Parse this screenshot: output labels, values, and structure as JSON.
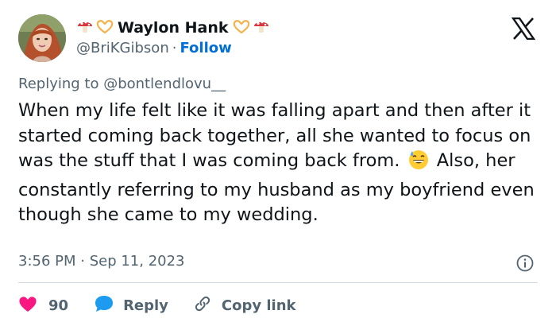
{
  "header": {
    "display_name": "Waylon Hank",
    "handle": "@BriKGibson",
    "separator": "·",
    "follow_label": "Follow"
  },
  "tweet": {
    "replying_to": "Replying to @bontlendlovu__",
    "text_part1": "When my life felt like it was falling apart and then after it started coming back together, all she wanted to focus on was the stuff that I was coming back from.",
    "text_part2": "Also, her constantly referring to my husband as my boyfriend even though she came to my wedding.",
    "timestamp": "3:56 PM · Sep 11, 2023"
  },
  "actions": {
    "like_count": "90",
    "reply_label": "Reply",
    "copy_link_label": "Copy link"
  },
  "icons": {
    "logo": "x-logo-icon",
    "info": "info-icon",
    "like": "heart-icon",
    "reply": "speech-bubble-icon",
    "copy": "link-icon",
    "inline_emoji": "grinning-sweat-emoji-icon",
    "name_decor": [
      "mushroom-icon",
      "heart-hands-icon"
    ]
  },
  "colors": {
    "text": "#0f1419",
    "secondary": "#536471",
    "follow": "#006fd6",
    "like": "#f91880",
    "reply": "#1d9bf0",
    "divider": "#cfd9de"
  }
}
